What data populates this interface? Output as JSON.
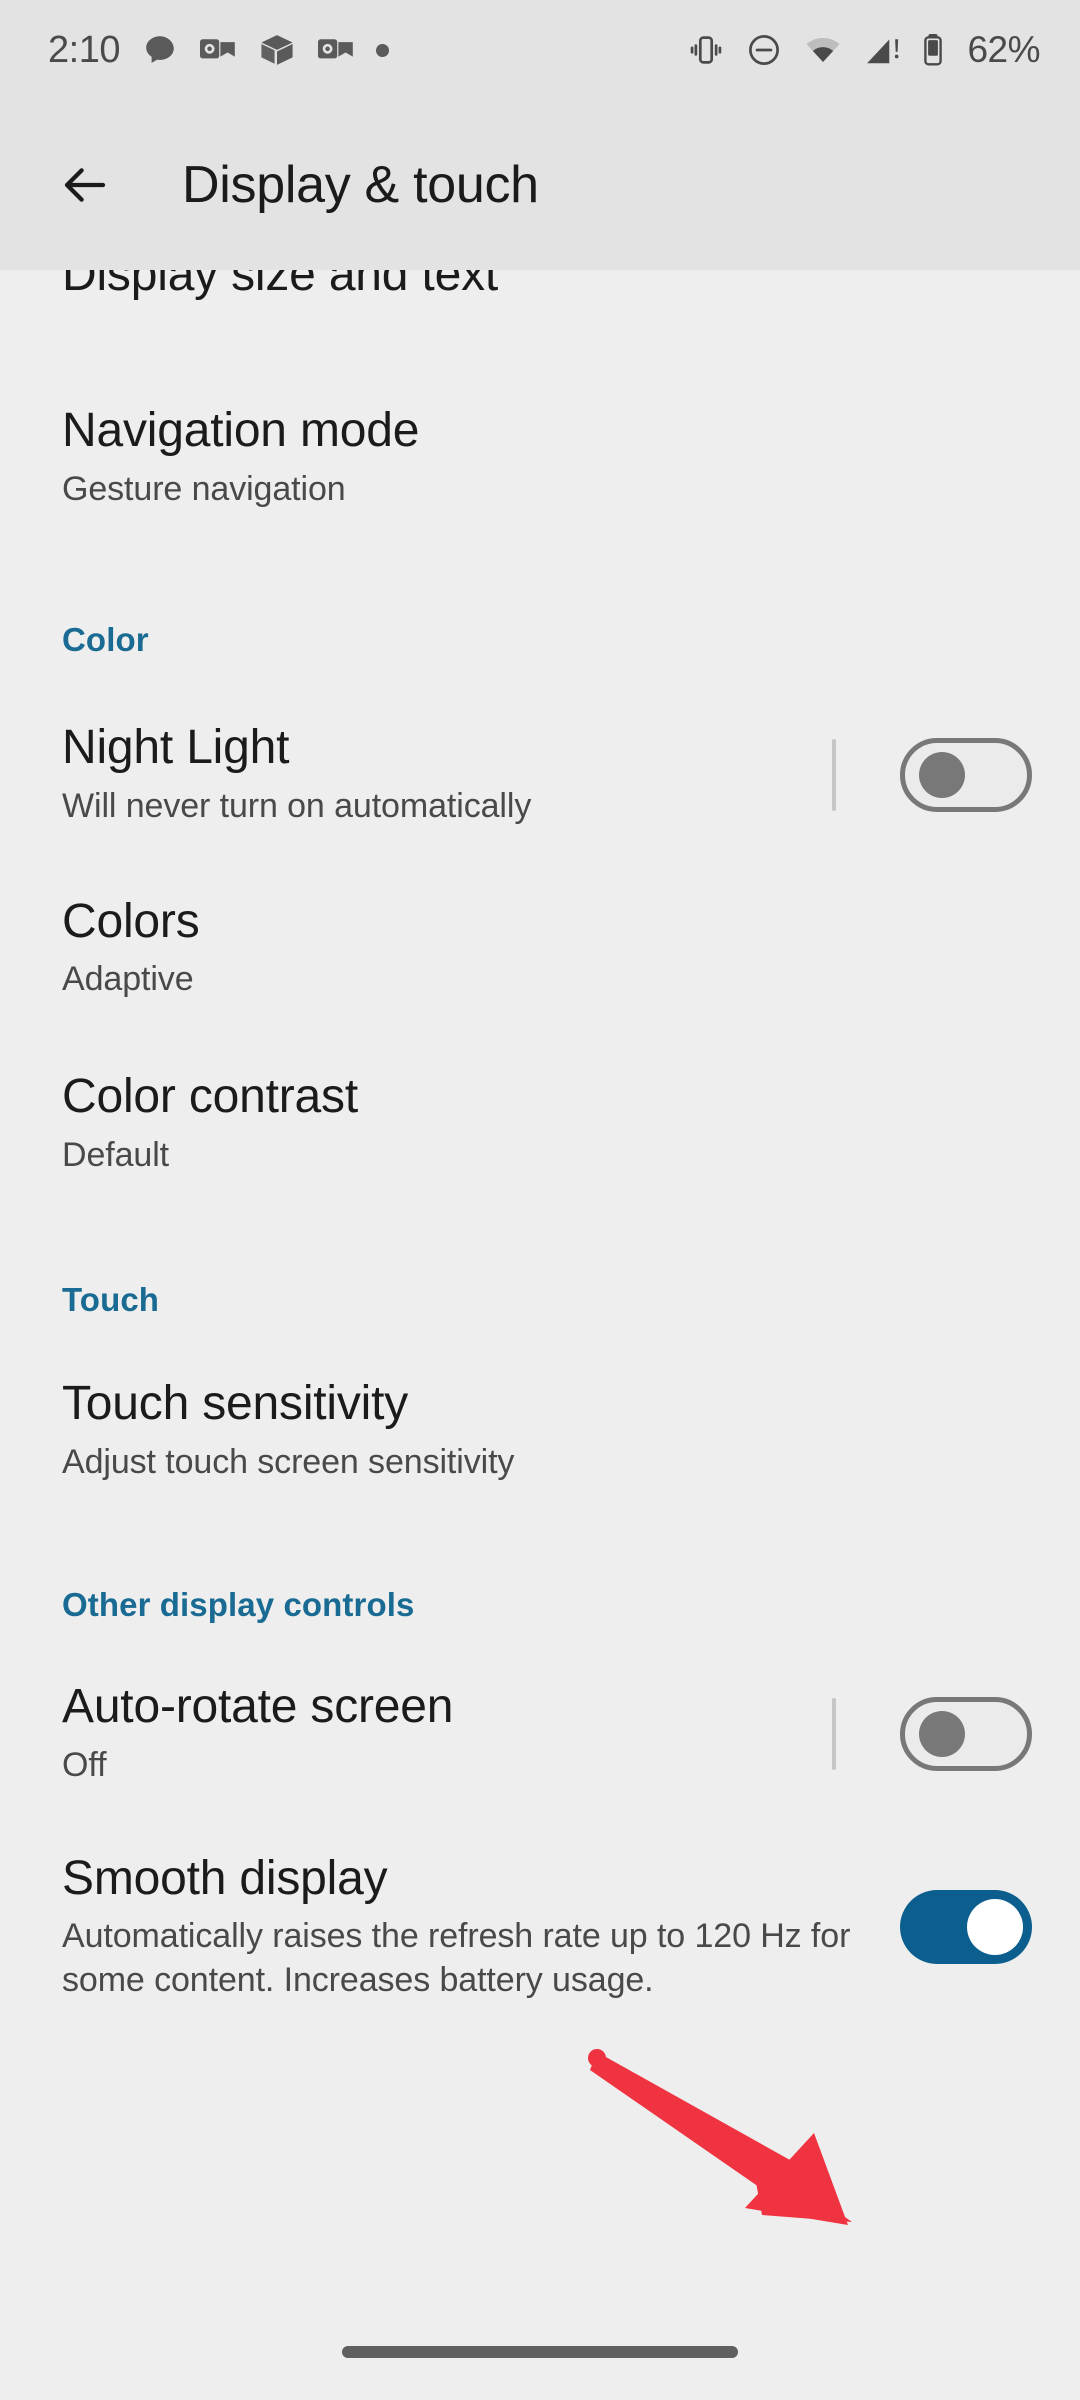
{
  "status_bar": {
    "time": "2:10",
    "battery_percent": "62%",
    "notification_icons": [
      "chat-bubble-icon",
      "outlook-icon",
      "package-box-icon",
      "outlook-icon",
      "dot-icon"
    ],
    "system_icons": [
      "vibrate-icon",
      "do-not-disturb-icon",
      "wifi-icon",
      "cellular-signal-warning-icon",
      "battery-icon"
    ]
  },
  "app_bar": {
    "back_icon": "back-arrow-icon",
    "title": "Display & touch"
  },
  "colors": {
    "accent_section_header": "#1A6B93",
    "toggle_on": "#0B5E8E",
    "toggle_off_track": "#787878",
    "annotation_arrow": "#F03340",
    "background": "#EEEEEE",
    "app_bar_background": "#E3E3E3"
  },
  "list": {
    "clipped_top_item": {
      "title": "Display size and text"
    },
    "items": [
      {
        "title": "Navigation mode",
        "subtitle": "Gesture navigation",
        "toggle": null
      },
      {
        "title": "Night Light",
        "subtitle": "Will never turn on automatically",
        "toggle": "off"
      },
      {
        "title": "Colors",
        "subtitle": "Adaptive",
        "toggle": null
      },
      {
        "title": "Color contrast",
        "subtitle": "Default",
        "toggle": null
      },
      {
        "title": "Touch sensitivity",
        "subtitle": "Adjust touch screen sensitivity",
        "toggle": null
      },
      {
        "title": "Auto-rotate screen",
        "subtitle": "Off",
        "toggle": "off"
      },
      {
        "title": "Smooth display",
        "subtitle": "Automatically raises the refresh rate up to 120 Hz for some content. Increases battery usage.",
        "toggle": "on"
      }
    ],
    "sections": {
      "color": "Color",
      "touch": "Touch",
      "other": "Other display controls"
    }
  },
  "annotation": {
    "type": "red-arrow",
    "points_to": "smooth-display-toggle"
  },
  "nav_bar": {
    "gesture_pill": "home-gesture-pill"
  }
}
